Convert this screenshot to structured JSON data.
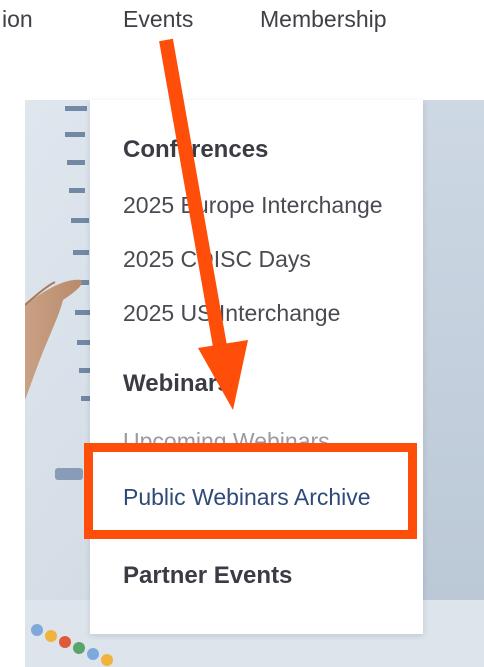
{
  "nav": {
    "items": [
      {
        "label": "ion"
      },
      {
        "label": "Events"
      },
      {
        "label": "Membership"
      }
    ]
  },
  "dropdown": {
    "conferences": {
      "heading": "Conferences",
      "items": [
        {
          "label": "2025 Europe Interchange"
        },
        {
          "label": "2025 CDISC Days"
        },
        {
          "label": "2025 US Interchange"
        }
      ]
    },
    "webinars": {
      "heading": "Webinars",
      "items": [
        {
          "label": "Upcoming Webinars"
        },
        {
          "label": "Public Webinars Archive"
        }
      ]
    },
    "partner_events": {
      "heading": "Partner Events"
    }
  },
  "annotation": {
    "color": "#ff4d0a"
  }
}
